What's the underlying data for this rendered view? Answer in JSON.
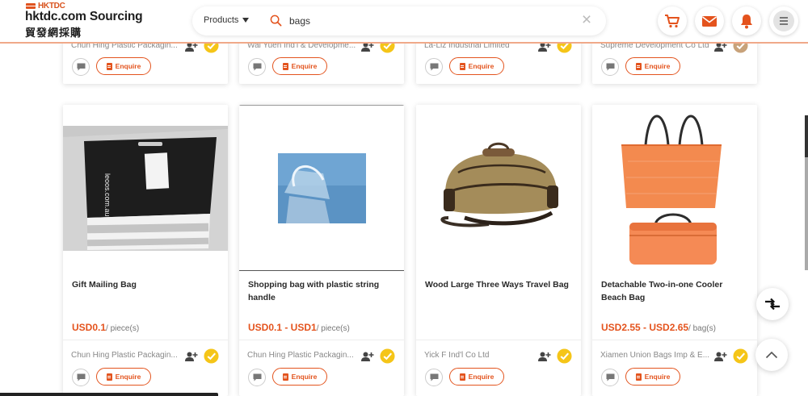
{
  "header": {
    "logo_small": "HKTDC",
    "logo_main": "hktdc.com Sourcing",
    "logo_sub": "貿發網採購",
    "product_select": "Products",
    "search_value": "bags"
  },
  "top_cards": [
    {
      "company": "Chun Hing Plastic Packagin...",
      "enquire": "Enquire"
    },
    {
      "company": "Wai Yuen Ind'l & Developme...",
      "enquire": "Enquire"
    },
    {
      "company": "La-Liz Industrial Limited",
      "enquire": "Enquire"
    },
    {
      "company": "Supreme Development Co Ltd",
      "enquire": "Enquire"
    }
  ],
  "products": [
    {
      "title": "Gift Mailing Bag",
      "price": "USD0.1",
      "unit": "/ piece(s)",
      "company": "Chun Hing Plastic Packagin...",
      "enquire": "Enquire",
      "image_text": "leoos.com.au"
    },
    {
      "title": "Shopping bag with plastic string handle",
      "price": "USD0.1 - USD1",
      "unit": "/ piece(s)",
      "company": "Chun Hing Plastic Packagin...",
      "enquire": "Enquire"
    },
    {
      "title": "Wood Large Three Ways Travel Bag",
      "price": "",
      "unit": "",
      "company": "Yick F Ind'l Co Ltd",
      "enquire": "Enquire"
    },
    {
      "title": "Detachable Two-in-one Cooler Beach Bag",
      "price": "USD2.55 - USD2.65",
      "unit": "/ bag(s)",
      "company": "Xiamen Union Bags Imp & E...",
      "enquire": "Enquire"
    }
  ],
  "colors": {
    "accent": "#e4531d",
    "verified": "#f5c518"
  },
  "icons": [
    "search-icon",
    "cart-icon",
    "mail-icon",
    "bell-icon",
    "menu-icon",
    "follow-icon",
    "verified-icon",
    "chat-icon",
    "compare-icon",
    "chevron-up-icon"
  ]
}
